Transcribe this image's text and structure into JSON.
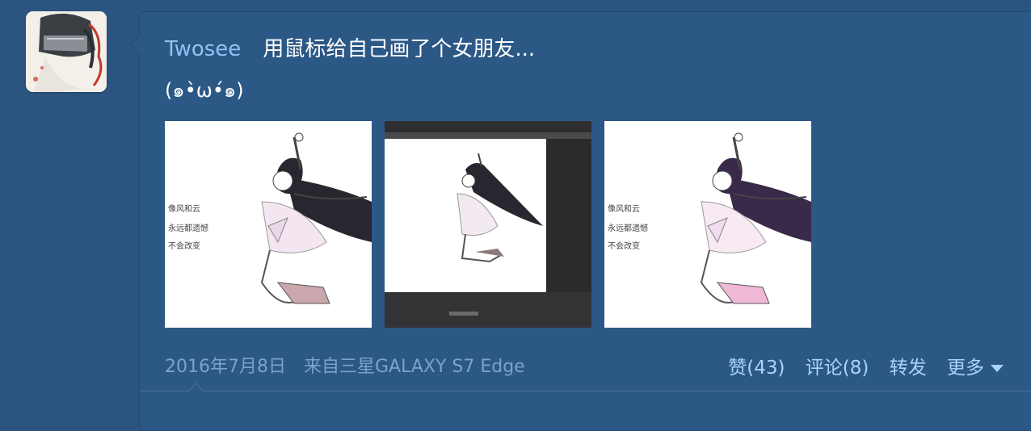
{
  "post": {
    "username": "Twosee",
    "title": "用鼠标给自己画了个女朋友...",
    "subtext": "(๑•̀ω•́๑)",
    "images": [
      {
        "name": "drawing-color",
        "caption_lines": [
          "像风和云",
          "永远都遗憾",
          "不会改变"
        ]
      },
      {
        "name": "drawing-editor-screenshot"
      },
      {
        "name": "drawing-color-alt",
        "caption_lines": [
          "像风和云",
          "永远都遗憾",
          "不会改变"
        ]
      }
    ],
    "date": "2016年7月8日",
    "source": "来自三星GALAXY S7 Edge",
    "actions": {
      "like": "赞(43)",
      "comment": "评论(8)",
      "repost": "转发",
      "more": "更多"
    }
  },
  "colors": {
    "background": "#2b5580",
    "username": "#8fc2ee",
    "meta": "#7aa3c8",
    "action": "#a9d4fb"
  }
}
